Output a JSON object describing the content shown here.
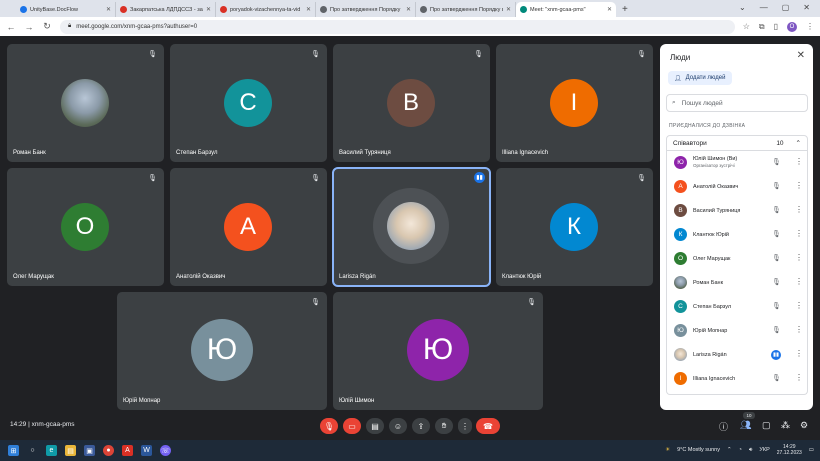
{
  "browser": {
    "tabs": [
      {
        "title": "UnityBase.DocFlow",
        "color": "#1a73e8",
        "active": false
      },
      {
        "title": "Закарпатська ЛДПДССЗ - запи",
        "color": "#d93025",
        "active": false
      },
      {
        "title": "poryadok-vizachennya-ta-vid",
        "color": "#d93025",
        "active": false
      },
      {
        "title": "Про затвердження Порядку",
        "color": "#5f6368",
        "active": false
      },
      {
        "title": "Про затвердження Порядку в",
        "color": "#5f6368",
        "active": false
      },
      {
        "title": "Meet: \"xnm-gcaa-pms\"",
        "color": "#00897b",
        "active": true
      }
    ],
    "url": "meet.google.com/xnm-gcaa-pms?authuser=0",
    "profile_initial": "O"
  },
  "tiles": [
    {
      "name": "Роман Банк",
      "type": "photo",
      "initial": ""
    },
    {
      "name": "Степан Барзул",
      "type": "initial",
      "initial": "С",
      "color": "#12939a"
    },
    {
      "name": "Василий Туряниця",
      "type": "initial",
      "initial": "В",
      "color": "#6d4c41"
    },
    {
      "name": "Illiana Ignacevich",
      "type": "initial",
      "initial": "I",
      "color": "#ef6c00"
    },
    {
      "name": "Олег Марущак",
      "type": "initial",
      "initial": "О",
      "color": "#2e7d32"
    },
    {
      "name": "Анатолій Оказвич",
      "type": "initial",
      "initial": "А",
      "color": "#f4511e"
    },
    {
      "name": "Larisza Rigán",
      "type": "photo2",
      "initial": ""
    },
    {
      "name": "Клантюк Юрій",
      "type": "initial",
      "initial": "К",
      "color": "#0288d1"
    },
    {
      "name": "Юрій Мопнар",
      "type": "initial",
      "initial": "Ю",
      "color": "#78909c"
    },
    {
      "name": "Юлій Шимон",
      "type": "initial",
      "initial": "Ю",
      "color": "#8e24aa"
    }
  ],
  "panel": {
    "title": "Люди",
    "add_people": "Додати людей",
    "search_placeholder": "Пошук людей",
    "joined_label": "ПРИЄДНАЛИСЯ ДО ДЗВІНКА",
    "group_label": "Співавтори",
    "group_count": "10",
    "participants": [
      {
        "name": "Юлій Шимон (Ви)",
        "sub": "Організатор зустрічі",
        "initial": "Ю",
        "color": "#8e24aa"
      },
      {
        "name": "Анатолій Оказвич",
        "initial": "А",
        "color": "#f4511e"
      },
      {
        "name": "Василий Туряниця",
        "initial": "В",
        "color": "#6d4c41"
      },
      {
        "name": "Клантюк Юрій",
        "initial": "К",
        "color": "#0288d1"
      },
      {
        "name": "Олег Марущак",
        "initial": "О",
        "color": "#2e7d32"
      },
      {
        "name": "Роман Банк",
        "initial": "",
        "color": "#8b9aa8"
      },
      {
        "name": "Степан Барзул",
        "initial": "С",
        "color": "#12939a"
      },
      {
        "name": "Юрій Мопнар",
        "initial": "Ю",
        "color": "#78909c"
      },
      {
        "name": "Larisza Rigán",
        "initial": "",
        "color": "#c9b8a0"
      },
      {
        "name": "Illiana Ignacevich",
        "initial": "I",
        "color": "#ef6c00"
      }
    ]
  },
  "bottom_bar": {
    "time_code": "14:29  |  xnm-gcaa-pms",
    "participants_badge": "10"
  },
  "taskbar": {
    "weather": "9°C  Mostly sunny",
    "lang": "УКР",
    "time": "14:29",
    "date": "27.12.2023"
  }
}
